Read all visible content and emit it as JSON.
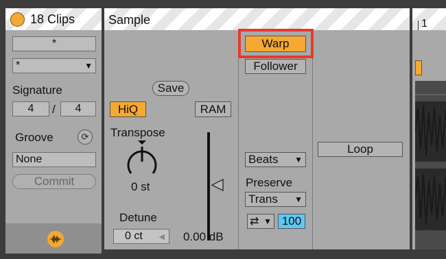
{
  "clip_panel": {
    "title": "18 Clips",
    "name_field": "*",
    "color_dropdown": "*",
    "signature_label": "Signature",
    "sig_numerator": "4",
    "sig_slash": "/",
    "sig_denominator": "4",
    "groove_label": "Groove",
    "groove_value": "None",
    "commit_label": "Commit"
  },
  "sample_panel": {
    "title": "Sample",
    "save_label": "Save",
    "hiq_label": "HiQ",
    "ram_label": "RAM",
    "transpose_label": "Transpose",
    "transpose_value": "0 st",
    "detune_label": "Detune",
    "detune_value": "0 ct",
    "gain_value": "0.00 dB",
    "warp_label": "Warp",
    "follower_label": "Follower",
    "warp_mode": "Beats",
    "preserve_label": "Preserve",
    "preserve_value": "Trans",
    "loop_mode_icon": "⇄",
    "loop_amount": "100",
    "loop_label": "Loop"
  },
  "arrangement": {
    "bar_number": "1"
  },
  "colors": {
    "clip_color": "#f5a832",
    "highlight": "#e8392a",
    "value_box": "#5ec8f5"
  }
}
